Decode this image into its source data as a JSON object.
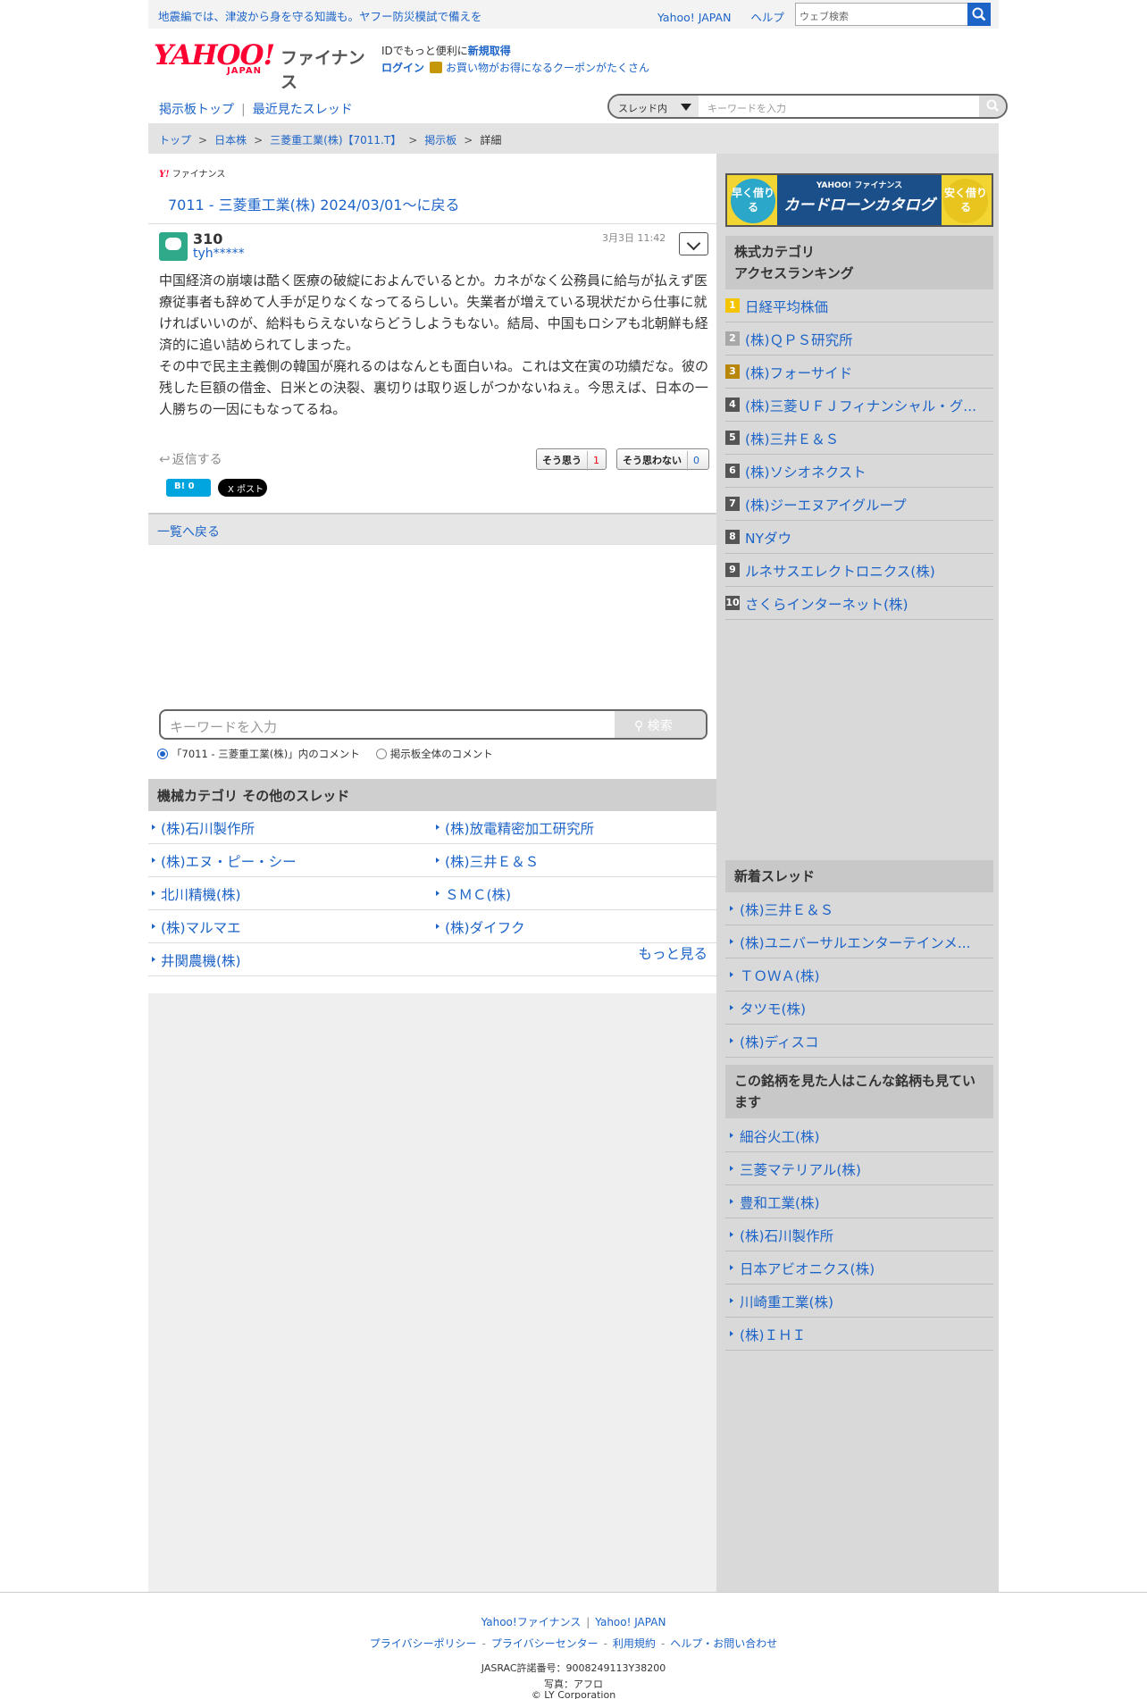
{
  "topbar": {
    "notice": "地震編では、津波から身を守る知識も。ヤフー防災模試で備えを",
    "yahoo_japan": "Yahoo! JAPAN",
    "help": "ヘルプ",
    "web_search_placeholder": "ウェブ検索"
  },
  "header": {
    "logo_text": "YAHOO!",
    "logo_sub": "JAPAN",
    "service": "ファイナンス",
    "id_prompt": "IDでもっと便利に",
    "signup": "新規取得",
    "login": "ログイン",
    "coupon": "お買い物がお得になるクーポンがたくさん"
  },
  "nav": {
    "board_top": "掲示板トップ",
    "recent": "最近見たスレッド",
    "scope": "スレッド内",
    "search_placeholder": "キーワードを入力"
  },
  "breadcrumb": [
    "トップ",
    "日本株",
    "三菱重工業(株)【7011.T】",
    "掲示板",
    "詳細"
  ],
  "thread": {
    "brand": "ファイナンス",
    "back_link": "7011 - 三菱重工業(株) 2024/03/01〜に戻る"
  },
  "post": {
    "number": "310",
    "user": "tyh*****",
    "date": "3月3日 11:42",
    "body": "中国経済の崩壊は酷く医療の破綻におよんでいるとか。カネがなく公務員に給与が払えず医療従事者も辞めて人手が足りなくなってるらしい。失業者が増えている現状だから仕事に就ければいいのが、給料もらえないならどうしようもない。結局、中国もロシアも北朝鮮も経済的に追い詰められてしまった。\nその中で民主主義側の韓国が廃れるのはなんとも面白いね。これは文在寅の功績だな。彼の残した巨額の借金、日米との決裂、裏切りは取り返しがつかないねぇ。今思えば、日本の一人勝ちの一因にもなってるね。",
    "reply": "返信する",
    "agree_label": "そう思う",
    "agree_count": "1",
    "disagree_label": "そう思わない",
    "disagree_count": "0",
    "hatena": "B! 0",
    "x_post": "X ポスト"
  },
  "back_to_list": "一覧へ戻る",
  "keyword_search": {
    "placeholder": "キーワードを入力",
    "button": "検索",
    "option_thread": "「7011 - 三菱重工業(株)」内のコメント",
    "option_all": "掲示板全体のコメント"
  },
  "other_threads": {
    "title": "機械カテゴリ  その他のスレッド",
    "items": [
      "(株)石川製作所",
      "(株)放電精密加工研究所",
      "(株)エヌ・ピー・シー",
      "(株)三井Ｅ＆Ｓ",
      "北川精機(株)",
      "ＳＭＣ(株)",
      "(株)マルマエ",
      "(株)ダイフク",
      "井関農機(株)"
    ],
    "more": "もっと見る"
  },
  "ad": {
    "left": "早く借りる",
    "brand": "YAHOO! ファイナンス",
    "title": "カードローンカタログ",
    "right": "安く借りる"
  },
  "ranking": {
    "title_line1": "株式カテゴリ",
    "title_line2": "アクセスランキング",
    "items": [
      "日経平均株価",
      "(株)ＱＰＳ研究所",
      "(株)フォーサイド",
      "(株)三菱ＵＦＪフィナンシャル・グ...",
      "(株)三井Ｅ＆Ｓ",
      "(株)ソシオネクスト",
      "(株)ジーエヌアイグループ",
      "NYダウ",
      "ルネサスエレクトロニクス(株)",
      "さくらインターネット(株)"
    ]
  },
  "new_threads": {
    "title": "新着スレッド",
    "items": [
      "(株)三井Ｅ＆Ｓ",
      "(株)ユニバーサルエンターテインメ...",
      "ＴＯＷＡ(株)",
      "タツモ(株)",
      "(株)ディスコ"
    ]
  },
  "also_viewed": {
    "title": "この銘柄を見た人はこんな銘柄も見ています",
    "items": [
      "細谷火工(株)",
      "三菱マテリアル(株)",
      "豊和工業(株)",
      "(株)石川製作所",
      "日本アビオニクス(株)",
      "川崎重工業(株)",
      "(株)ＩＨＩ"
    ]
  },
  "footer": {
    "yahoo_finance": "Yahoo!ファイナンス",
    "yahoo_japan": "Yahoo! JAPAN",
    "privacy_policy": "プライバシーポリシー",
    "privacy_center": "プライバシーセンター",
    "terms": "利用規約",
    "help": "ヘルプ・お問い合わせ",
    "jasrac": "JASRAC許諾番号：9008249113Y38200",
    "photo": "写真：アフロ",
    "copyright": "© LY Corporation"
  },
  "colors": {
    "link": "#1d64c8",
    "brand_red": "#ff0033",
    "agree": "#e60012"
  }
}
